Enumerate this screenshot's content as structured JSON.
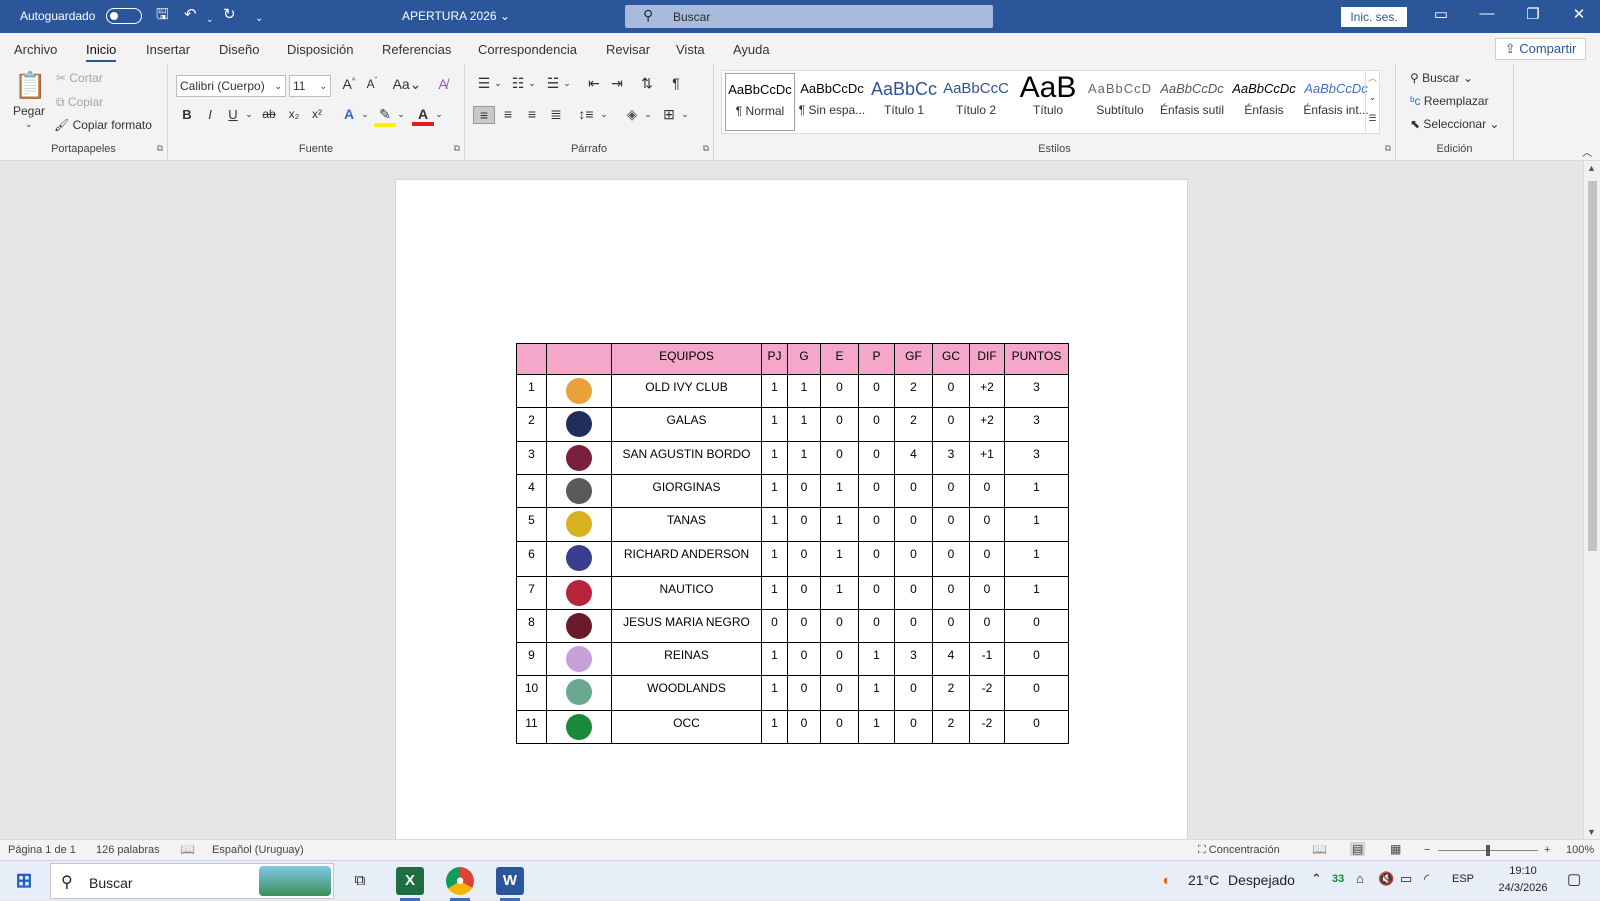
{
  "titlebar": {
    "autosave_label": "Autoguardado",
    "doc_title": "APERTURA 2026",
    "search_placeholder": "Buscar",
    "signin_label": "Inic. ses."
  },
  "ribbon_tabs": [
    "Archivo",
    "Inicio",
    "Insertar",
    "Diseño",
    "Disposición",
    "Referencias",
    "Correspondencia",
    "Revisar",
    "Vista",
    "Ayuda"
  ],
  "share_label": "Compartir",
  "clipboard": {
    "paste": "Pegar",
    "cut": "Cortar",
    "copy": "Copiar",
    "format_painter": "Copiar formato",
    "group": "Portapapeles"
  },
  "font": {
    "family": "Calibri (Cuerpo)",
    "size": "11",
    "group": "Fuente"
  },
  "paragraph": {
    "group": "Párrafo"
  },
  "styles": {
    "items": [
      {
        "preview": "AaBbCcDc",
        "name": "¶ Normal"
      },
      {
        "preview": "AaBbCcDc",
        "name": "¶ Sin espa..."
      },
      {
        "preview": "AaBbCc",
        "name": "Título 1"
      },
      {
        "preview": "AaBbCcC",
        "name": "Título 2"
      },
      {
        "preview": "AaB",
        "name": "Título"
      },
      {
        "preview": "AaBbCcD",
        "name": "Subtítulo"
      },
      {
        "preview": "AaBbCcDc",
        "name": "Énfasis sutil"
      },
      {
        "preview": "AaBbCcDc",
        "name": "Énfasis"
      },
      {
        "preview": "AaBbCcDc",
        "name": "Énfasis int..."
      }
    ],
    "group": "Estilos"
  },
  "editing": {
    "find": "Buscar",
    "replace": "Reemplazar",
    "select": "Seleccionar",
    "group": "Edición"
  },
  "standings": {
    "headers": [
      "",
      "",
      "EQUIPOS",
      "PJ",
      "G",
      "E",
      "P",
      "GF",
      "GC",
      "DIF",
      "PUNTOS"
    ],
    "rows": [
      {
        "pos": "1",
        "team": "OLD IVY CLUB",
        "pj": "1",
        "g": "1",
        "e": "0",
        "p": "0",
        "gf": "2",
        "gc": "0",
        "dif": "+2",
        "pts": "3",
        "logo_color": "#e9a23b"
      },
      {
        "pos": "2",
        "team": "GALAS",
        "pj": "1",
        "g": "1",
        "e": "0",
        "p": "0",
        "gf": "2",
        "gc": "0",
        "dif": "+2",
        "pts": "3",
        "logo_color": "#1f2f5c"
      },
      {
        "pos": "3",
        "team": "SAN AGUSTIN BORDO",
        "pj": "1",
        "g": "1",
        "e": "0",
        "p": "0",
        "gf": "4",
        "gc": "3",
        "dif": "+1",
        "pts": "3",
        "logo_color": "#7a1f3d"
      },
      {
        "pos": "4",
        "team": "GIORGINAS",
        "pj": "1",
        "g": "0",
        "e": "1",
        "p": "0",
        "gf": "0",
        "gc": "0",
        "dif": "0",
        "pts": "1",
        "logo_color": "#5a5a5a"
      },
      {
        "pos": "5",
        "team": "TANAS",
        "pj": "1",
        "g": "0",
        "e": "1",
        "p": "0",
        "gf": "0",
        "gc": "0",
        "dif": "0",
        "pts": "1",
        "logo_color": "#d9b21f"
      },
      {
        "pos": "6",
        "team": "RICHARD ANDERSON",
        "pj": "1",
        "g": "0",
        "e": "1",
        "p": "0",
        "gf": "0",
        "gc": "0",
        "dif": "0",
        "pts": "1",
        "logo_color": "#3a3d8f"
      },
      {
        "pos": "7",
        "team": "NAUTICO",
        "pj": "1",
        "g": "0",
        "e": "1",
        "p": "0",
        "gf": "0",
        "gc": "0",
        "dif": "0",
        "pts": "1",
        "logo_color": "#b8243a"
      },
      {
        "pos": "8",
        "team": "JESUS MARIA NEGRO",
        "pj": "0",
        "g": "0",
        "e": "0",
        "p": "0",
        "gf": "0",
        "gc": "0",
        "dif": "0",
        "pts": "0",
        "logo_color": "#6b1a2c"
      },
      {
        "pos": "9",
        "team": "REINAS",
        "pj": "1",
        "g": "0",
        "e": "0",
        "p": "1",
        "gf": "3",
        "gc": "4",
        "dif": "-1",
        "pts": "0",
        "logo_color": "#c7a0d8"
      },
      {
        "pos": "10",
        "team": "WOODLANDS",
        "pj": "1",
        "g": "0",
        "e": "0",
        "p": "1",
        "gf": "0",
        "gc": "2",
        "dif": "-2",
        "pts": "0",
        "logo_color": "#6aa88f"
      },
      {
        "pos": "11",
        "team": "OCC",
        "pj": "1",
        "g": "0",
        "e": "0",
        "p": "1",
        "gf": "0",
        "gc": "2",
        "dif": "-2",
        "pts": "0",
        "logo_color": "#1a8a3a"
      }
    ]
  },
  "statusbar": {
    "page": "Página 1 de 1",
    "words": "126 palabras",
    "language": "Español (Uruguay)",
    "focus": "Concentración",
    "zoom": "100%"
  },
  "taskbar": {
    "search": "Buscar",
    "weather_temp": "21°C",
    "weather_text": "Despejado",
    "badge": "33",
    "lang": "ESP",
    "time": "19:10",
    "date": "24/3/2026"
  },
  "colors": {
    "accent": "#2b579a",
    "header_pink": "#f4a7c8"
  }
}
